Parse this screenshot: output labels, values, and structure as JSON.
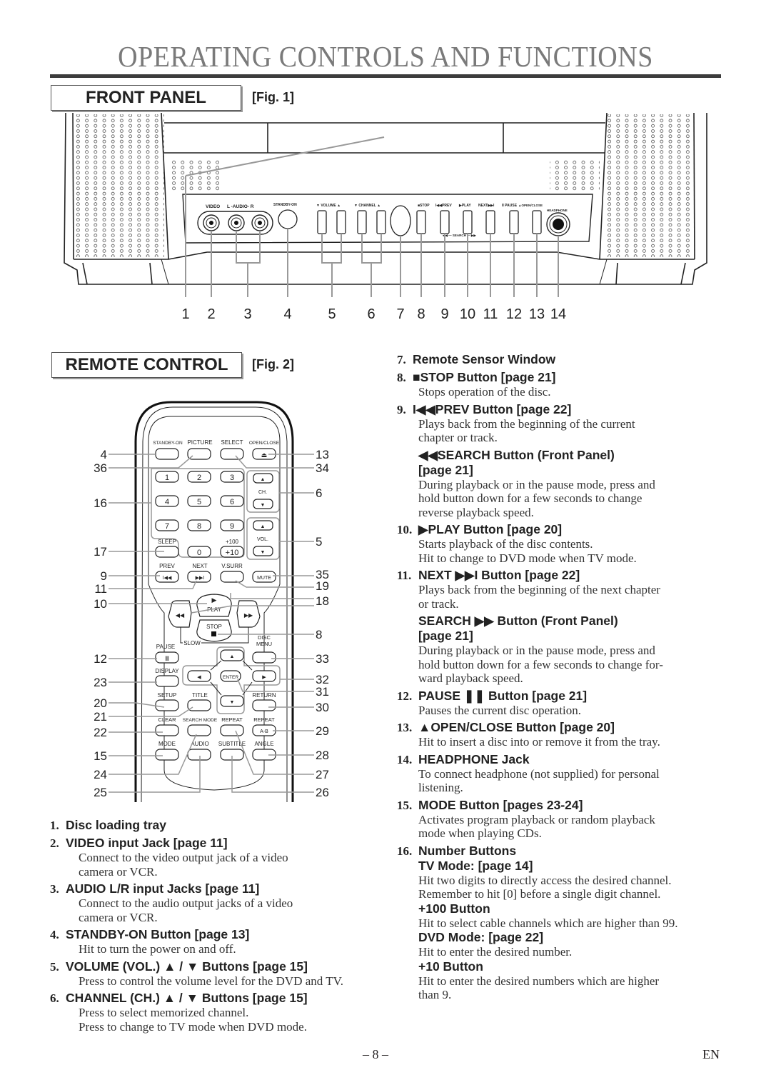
{
  "page": {
    "title": "OPERATING CONTROLS AND FUNCTIONS",
    "page_number": "– 8 –",
    "language": "EN"
  },
  "front_panel": {
    "heading": "FRONT PANEL",
    "fig": "[Fig. 1]",
    "panel_labels": {
      "video": "VIDEO",
      "audio": "L  -AUDIO-  R",
      "standby": "STANDBY-ON",
      "volume": "▼ VOLUME ▲",
      "channel": "▼ CHANNEL ▲",
      "stop": "■STOP",
      "prev": "I◀◀PREV",
      "play": "▶PLAY",
      "next": "NEXT▶▶I",
      "pause": "II PAUSE",
      "open_close": "▲OPEN/CLOSE",
      "headphone": "HEADPHONE",
      "search": "◀◀ — SEARCH — ▶▶"
    },
    "callouts": [
      "1",
      "2",
      "3",
      "4",
      "5",
      "6",
      "7",
      "8",
      "9",
      "10",
      "11",
      "12",
      "13",
      "14"
    ]
  },
  "remote_control": {
    "heading": "REMOTE CONTROL",
    "fig": "[Fig. 2]",
    "button_labels": {
      "standby_on": "STANDBY-ON",
      "picture": "PICTURE",
      "select": "SELECT",
      "open_close": "OPEN/CLOSE",
      "digits": [
        "1",
        "2",
        "3",
        "4",
        "5",
        "6",
        "7",
        "8",
        "9",
        "0"
      ],
      "plus10": "+10",
      "plus100": "+100",
      "sleep": "SLEEP",
      "ch": "CH.",
      "vol": "VOL.",
      "prev": "PREV",
      "next": "NEXT",
      "vsurr": "V.SURR",
      "mute": "MUTE",
      "play": "PLAY",
      "stop": "STOP",
      "pause": "PAUSE",
      "slow": "SLOW",
      "disc_menu_1": "DISC",
      "disc_menu_2": "MENU",
      "display": "DISPLAY",
      "enter": "ENTER",
      "setup": "SETUP",
      "title": "TITLE",
      "return": "RETURN",
      "clear": "CLEAR",
      "search_mode": "SEARCH MODE",
      "repeat": "REPEAT",
      "repeat_ab": "REPEAT",
      "ab": "A-B",
      "mode": "MODE",
      "audio": "AUDIO",
      "subtitle": "SUBTITLE",
      "angle": "ANGLE"
    },
    "left_callouts": [
      "4",
      "36",
      "16",
      "17",
      "9",
      "11",
      "10",
      "12",
      "23",
      "20",
      "21",
      "22",
      "15",
      "24",
      "25"
    ],
    "right_callouts": [
      "13",
      "34",
      "6",
      "5",
      "35",
      "19",
      "18",
      "8",
      "33",
      "32",
      "31",
      "30",
      "29",
      "28",
      "27",
      "26"
    ]
  },
  "descriptions_left": [
    {
      "num": "1.",
      "title": "Disc loading tray",
      "body": []
    },
    {
      "num": "2.",
      "title": "VIDEO input Jack [page 11]",
      "body": [
        "Connect to the video output jack of a video",
        "camera or VCR."
      ]
    },
    {
      "num": "3.",
      "title": "AUDIO L/R input Jacks [page 11]",
      "body": [
        "Connect to the audio output jacks of a video",
        "camera or VCR."
      ]
    },
    {
      "num": "4.",
      "title": "STANDBY-ON Button [page 13]",
      "body": [
        "Hit to turn the power on and off."
      ]
    },
    {
      "num": "5.",
      "title": "VOLUME (VOL.) ▲ / ▼ Buttons [page 15]",
      "body": [
        "Press to control the volume level for the DVD and TV."
      ]
    },
    {
      "num": "6.",
      "title": "CHANNEL (CH.) ▲ / ▼ Buttons [page 15]",
      "body": [
        "Press to select memorized channel.",
        "Press to change to TV mode when DVD mode."
      ]
    }
  ],
  "descriptions_right": [
    {
      "num": "7.",
      "title": "Remote Sensor Window",
      "body": []
    },
    {
      "num": "8.",
      "title": "■STOP Button [page 21]",
      "body": [
        "Stops operation of the disc."
      ]
    },
    {
      "num": "9.",
      "title": "I◀◀PREV Button [page 22]",
      "body": [
        "Plays back from the beginning of the current",
        "chapter or track."
      ],
      "sub": [
        {
          "title": "◀◀SEARCH  Button (Front Panel)",
          "title2": "[page 21]",
          "body": [
            "During playback or in the pause mode, press and",
            "hold button down for a few seconds to change",
            "reverse playback speed."
          ]
        }
      ]
    },
    {
      "num": "10.",
      "title": "▶PLAY Button [page 20]",
      "body": [
        "Starts playback of the disc contents.",
        "Hit to change to DVD mode when TV mode."
      ]
    },
    {
      "num": "11.",
      "title": "NEXT ▶▶I Button [page 22]",
      "body": [
        "Plays back from the beginning of the next chapter",
        "or track."
      ],
      "sub": [
        {
          "title": "SEARCH ▶▶  Button (Front Panel)",
          "title2": "[page 21]",
          "body": [
            "During playback or in the pause mode, press and",
            "hold button down for a few seconds to change for-",
            "ward playback speed."
          ]
        }
      ]
    },
    {
      "num": "12.",
      "title": "PAUSE ❚❚ Button [page 21]",
      "body": [
        "Pauses the current disc operation."
      ]
    },
    {
      "num": "13.",
      "title": "▲OPEN/CLOSE  Button [page 20]",
      "body": [
        "Hit to insert a disc into or remove it from the tray."
      ]
    },
    {
      "num": "14.",
      "title": "HEADPHONE Jack",
      "body": [
        "To connect headphone (not supplied) for personal",
        "listening."
      ]
    },
    {
      "num": "15.",
      "title": "MODE Button [pages 23-24]",
      "body": [
        "Activates program playback or random playback",
        "mode when playing CDs."
      ]
    },
    {
      "num": "16.",
      "title": "Number Buttons",
      "body": [],
      "sub": [
        {
          "title": "TV Mode: [page 14]",
          "body": [
            "Hit two digits to directly access the desired channel.",
            "Remember to hit [0] before a single digit channel."
          ]
        },
        {
          "title": "+100 Button",
          "body": [
            "Hit to select cable channels which are higher than 99."
          ]
        },
        {
          "title": "DVD Mode: [page 22]",
          "body": [
            "Hit to enter the desired number."
          ]
        },
        {
          "title": "+10 Button",
          "body": [
            "Hit to enter the desired numbers which are higher",
            "than 9."
          ]
        }
      ]
    }
  ]
}
